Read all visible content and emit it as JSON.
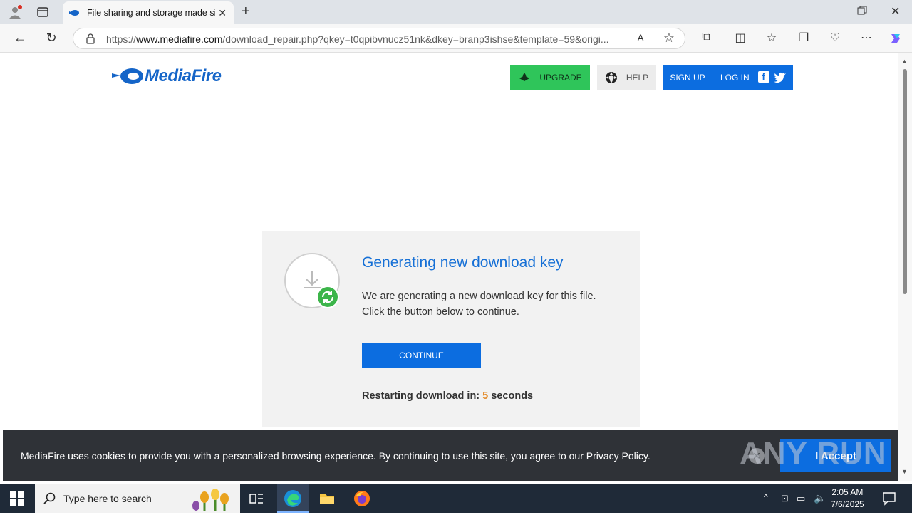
{
  "browser": {
    "tab_title": "File sharing and storage made sim",
    "url_prefix": "https://",
    "url_domain": "www.mediafire.com",
    "url_rest": "/download_repair.php?qkey=t0qpibvnucz51nk&dkey=branp3ishse&template=59&origi..."
  },
  "header": {
    "logo_text": "MediaFire",
    "upgrade_label": "UPGRADE",
    "help_label": "HELP",
    "signup_label": "SIGN UP",
    "login_label": "LOG IN"
  },
  "card": {
    "title": "Generating new download key",
    "desc_line1": "We are generating a new download key for this file.",
    "desc_line2": "Click the button below to continue.",
    "continue_label": "CONTINUE",
    "restart_prefix": "Restarting download in:",
    "restart_count": "5",
    "restart_suffix": "seconds"
  },
  "cookie": {
    "message": "MediaFire uses cookies to provide you with a personalized browsing experience. By continuing to use this site, you agree to our Privacy Policy.",
    "accept_label": "I Accept",
    "watermark": "ANY RUN"
  },
  "taskbar": {
    "search_placeholder": "Type here to search",
    "time": "2:05 AM",
    "date": "7/6/2025"
  },
  "colors": {
    "brand_blue": "#0c6de0",
    "upgrade_green": "#2fc55a",
    "countdown_orange": "#e38c2c"
  }
}
